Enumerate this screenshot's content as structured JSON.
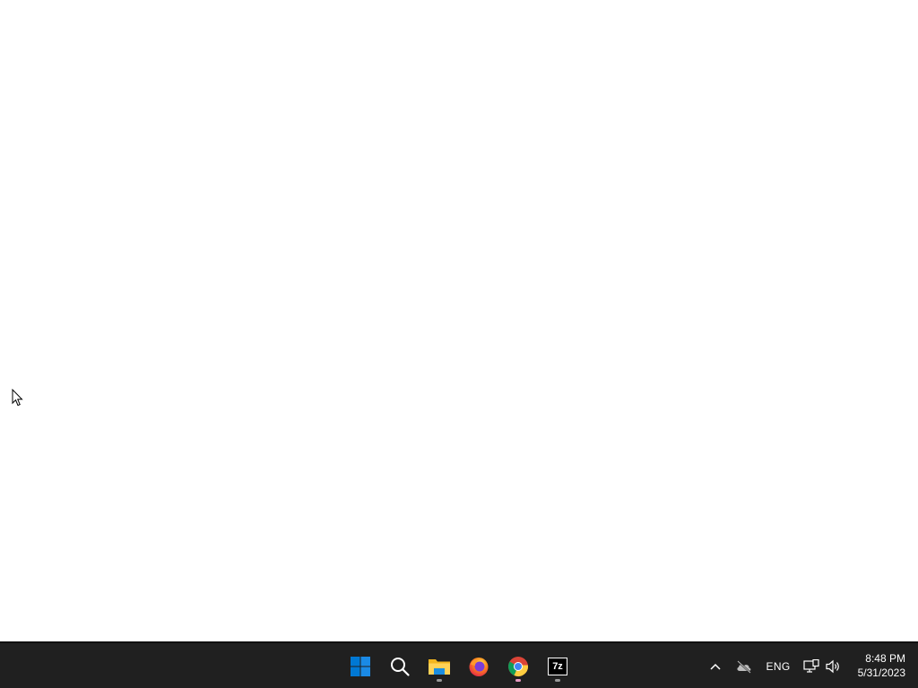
{
  "taskbar": {
    "pinned": [
      {
        "name": "start-button",
        "icon": "windows-logo-icon",
        "running": false
      },
      {
        "name": "search-button",
        "icon": "search-icon",
        "running": false
      },
      {
        "name": "file-explorer-button",
        "icon": "folder-icon",
        "running": true
      },
      {
        "name": "firefox-button",
        "icon": "firefox-icon",
        "running": false
      },
      {
        "name": "chrome-button",
        "icon": "chrome-icon",
        "running": true,
        "active": true
      },
      {
        "name": "7zip-button",
        "icon": "7zip-icon",
        "label": "7z",
        "running": true
      }
    ],
    "tray": {
      "overflow_icon": "chevron-up-icon",
      "cloud_icon": "onedrive-offline-icon",
      "language": "ENG",
      "network_icon": "network-icon",
      "volume_icon": "speaker-icon"
    },
    "clock": {
      "time": "8:48 PM",
      "date": "5/31/2023"
    }
  },
  "colors": {
    "taskbar_bg": "#202020",
    "desktop_bg": "#ffffff",
    "windows_blue": "#0078d4",
    "active_indicator": "#e99ac3"
  }
}
